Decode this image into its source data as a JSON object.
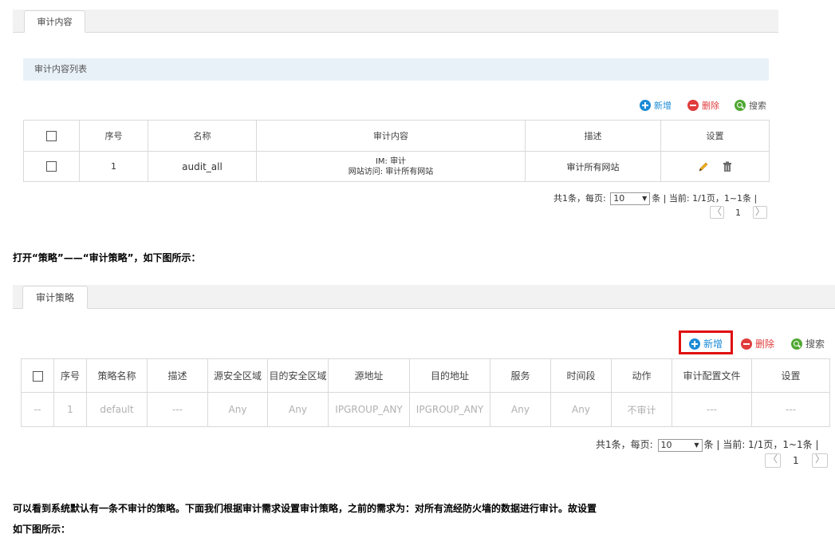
{
  "panel1": {
    "tab": "审计内容",
    "section_title": "审计内容列表",
    "toolbar": {
      "add": "新增",
      "delete": "删除",
      "search": "搜索"
    },
    "table": {
      "headers": [
        "序号",
        "名称",
        "审计内容",
        "描述",
        "设置"
      ],
      "rows": [
        {
          "index": "1",
          "name": "audit_all",
          "content_line1": "IM: 审计",
          "content_line2": "网站访问: 审计所有网站",
          "desc": "审计所有网站"
        }
      ]
    },
    "pager": {
      "summary_pre": "共1条，每页:",
      "per_page": "10",
      "summary_post": "条 | 当前: 1/1页，1~1条 |",
      "prev": "〈",
      "page": "1",
      "next": "〉"
    }
  },
  "text1": "打开“策略”——“审计策略”，如下图所示：",
  "panel2": {
    "tab": "审计策略",
    "toolbar": {
      "add": "新增",
      "delete": "删除",
      "search": "搜索"
    },
    "table": {
      "headers": [
        "序号",
        "策略名称",
        "描述",
        "源安全区域",
        "目的安全区域",
        "源地址",
        "目的地址",
        "服务",
        "时间段",
        "动作",
        "审计配置文件",
        "设置"
      ],
      "row": [
        "--",
        "1",
        "default",
        "---",
        "Any",
        "Any",
        "IPGROUP_ANY",
        "IPGROUP_ANY",
        "Any",
        "Any",
        "不审计",
        "---",
        "---"
      ]
    },
    "pager": {
      "summary_pre": "共1条，每页:",
      "per_page": "10",
      "summary_post": "条 | 当前: 1/1页，1~1条 |",
      "prev": "〈",
      "page": "1",
      "next": "〉"
    }
  },
  "text2_line1": "可以看到系统默认有一条不审计的策略。下面我们根据审计需求设置审计策略，之前的需求为：对所有流经防火墙的数据进行审计。故设置",
  "text2_line2": "如下图所示：",
  "colors": {
    "add_blue": "#1d8bd6",
    "delete_red": "#e03c3c",
    "search_green": "#4fa832",
    "highlight_red": "#e01010"
  }
}
